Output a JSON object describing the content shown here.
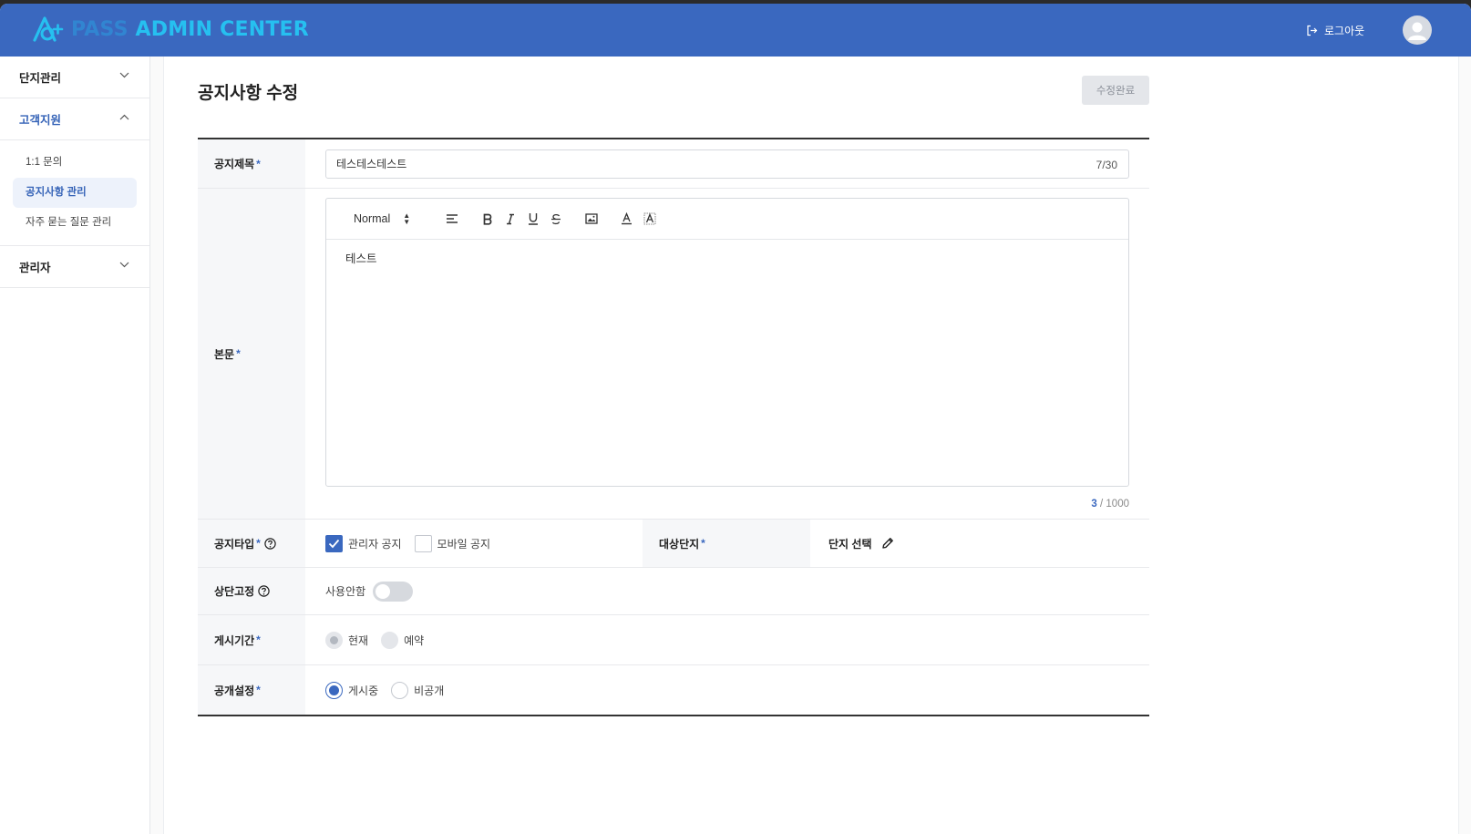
{
  "header": {
    "logo_pass": "PASS",
    "logo_admin": "ADMIN CENTER",
    "logout_label": "로그아웃",
    "logout_icon": "logout-icon",
    "avatar_icon": "user-avatar-icon",
    "color": "#3a68bf"
  },
  "sidebar": {
    "groups": [
      {
        "label": "단지관리",
        "expanded": false
      },
      {
        "label": "고객지원",
        "expanded": true
      },
      {
        "label": "관리자",
        "expanded": false
      }
    ],
    "support_items": [
      {
        "label": "1:1 문의",
        "active": false
      },
      {
        "label": "공지사항 관리",
        "active": true
      },
      {
        "label": "자주 묻는 질문 관리",
        "active": false
      }
    ]
  },
  "page": {
    "title": "공지사항 수정",
    "submit_label": "수정완료"
  },
  "form": {
    "title_label": "공지제목",
    "title_value": "테스테스테스트",
    "title_count": "7/30",
    "body_label": "본문",
    "editor_format": "Normal",
    "body_value": "테스트",
    "body_count_current": "3",
    "body_count_max": " / 1000",
    "type_label": "공지타입",
    "type_options": [
      {
        "label": "관리자 공지",
        "checked": true
      },
      {
        "label": "모바일 공지",
        "checked": false
      }
    ],
    "target_label": "대상단지",
    "target_select_label": "단지 선택",
    "pin_label": "상단고정",
    "pin_status": "사용안함",
    "pin_enabled": false,
    "period_label": "게시기간",
    "period_options": [
      {
        "label": "현재",
        "selected": true
      },
      {
        "label": "예약",
        "selected": false
      }
    ],
    "visibility_label": "공개설정",
    "visibility_options": [
      {
        "label": "게시중",
        "selected": true
      },
      {
        "label": "비공개",
        "selected": false
      }
    ],
    "required_mark": "*"
  }
}
